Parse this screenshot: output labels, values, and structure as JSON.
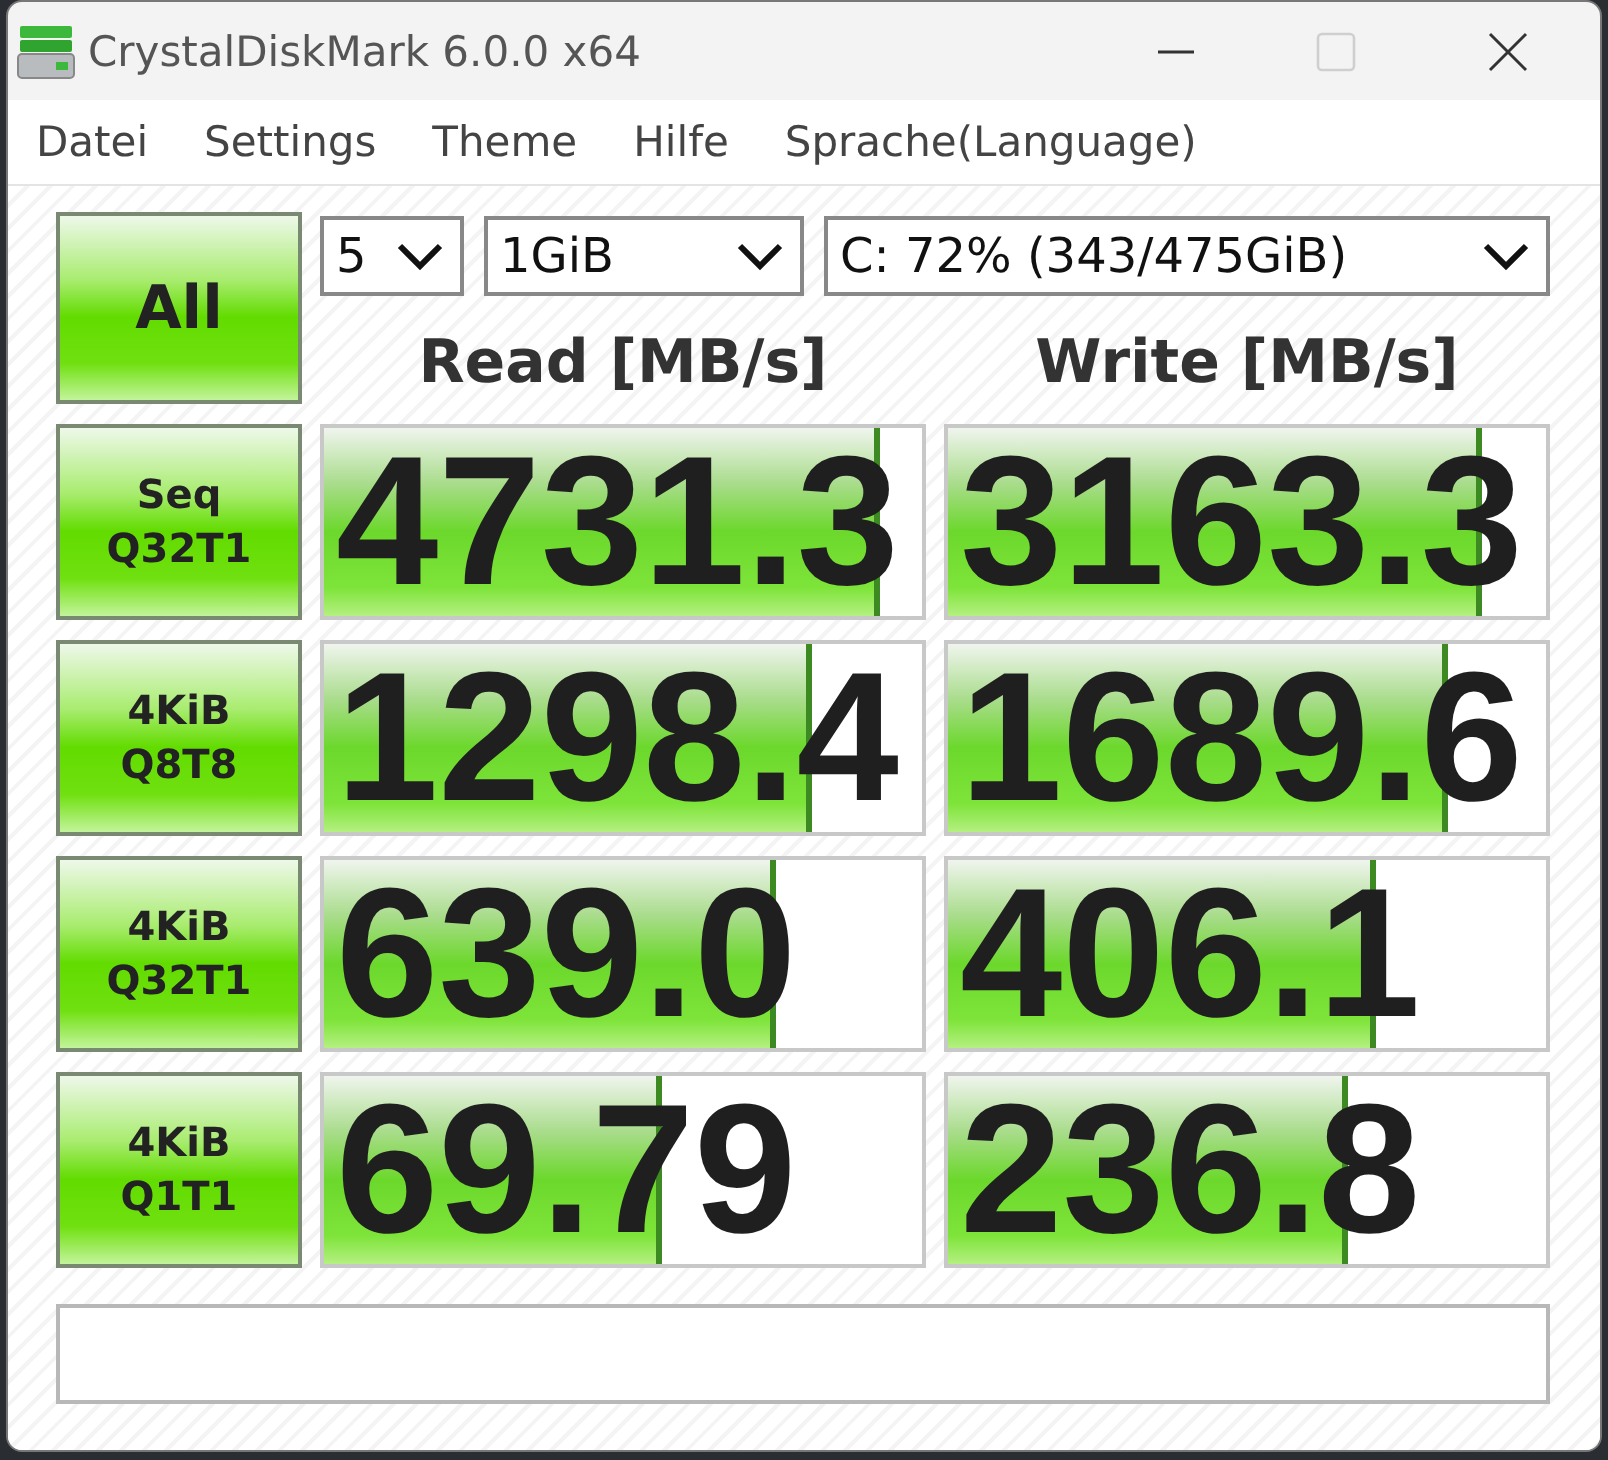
{
  "window": {
    "title": "CrystalDiskMark 6.0.0 x64",
    "controls": [
      {
        "kind": "minimize",
        "disabled": false
      },
      {
        "kind": "maximize",
        "disabled": true
      },
      {
        "kind": "close",
        "disabled": false
      }
    ]
  },
  "menu": [
    "Datei",
    "Settings",
    "Theme",
    "Hilfe",
    "Sprache(Language)"
  ],
  "all_button": "All",
  "selectors": [
    {
      "value": "5"
    },
    {
      "value": "1GiB"
    },
    {
      "value": "C: 72% (343/475GiB)"
    }
  ],
  "headers": {
    "read": "Read [MB/s]",
    "write": "Write [MB/s]"
  },
  "tests": [
    {
      "label": "Seq\nQ32T1",
      "read": {
        "value": "4731.3",
        "level": 0.93
      },
      "write": {
        "value": "3163.3",
        "level": 0.894
      }
    },
    {
      "label": "4KiB\nQ8T8",
      "read": {
        "value": "1298.4",
        "level": 0.815
      },
      "write": {
        "value": "1689.6",
        "level": 0.835
      }
    },
    {
      "label": "4KiB\nQ32T1",
      "read": {
        "value": "639.0",
        "level": 0.755
      },
      "write": {
        "value": "406.1",
        "level": 0.716
      }
    },
    {
      "label": "4KiB\nQ1T1",
      "read": {
        "value": "69.79",
        "level": 0.564
      },
      "write": {
        "value": "236.8",
        "level": 0.67
      }
    }
  ]
}
